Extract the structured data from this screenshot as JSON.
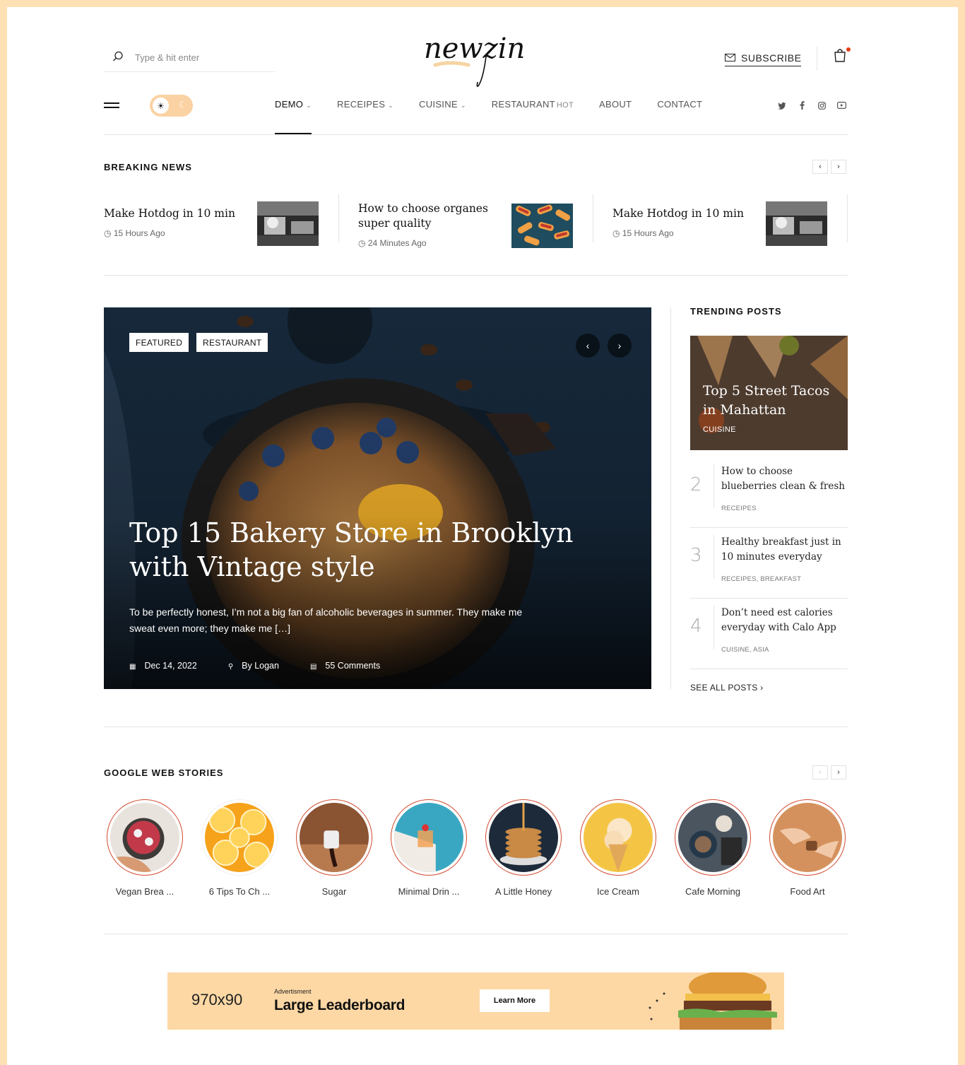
{
  "header": {
    "search_placeholder": "Type & hit enter",
    "logo_text": "newzin",
    "subscribe_label": "SUBSCRIBE"
  },
  "nav": {
    "items": [
      {
        "label": "DEMO",
        "caret": true,
        "active": true
      },
      {
        "label": "RECEIPES",
        "caret": true
      },
      {
        "label": "CUISINE",
        "caret": true
      },
      {
        "label": "RESTAURANT",
        "badge": "HOT"
      },
      {
        "label": "ABOUT"
      },
      {
        "label": "CONTACT"
      }
    ],
    "social_icons": [
      "twitter-icon",
      "facebook-icon",
      "instagram-icon",
      "youtube-icon"
    ]
  },
  "breaking": {
    "title": "BREAKING NEWS",
    "items": [
      {
        "title": "Make Hotdog in 10 min",
        "time": "15 Hours Ago"
      },
      {
        "title": "How to choose organes super quality",
        "time": "24 Minutes Ago"
      },
      {
        "title": "Make Hotdog in 10 min",
        "time": "15 Hours Ago"
      }
    ]
  },
  "hero": {
    "badges": [
      "FEATURED",
      "RESTAURANT"
    ],
    "title": "Top 15 Bakery Store in Brooklyn with Vintage style",
    "excerpt": "To be perfectly honest, I’m not a big fan of alcoholic beverages in summer. They make me sweat even more; they make me […]",
    "date": "Dec 14, 2022",
    "author": "By Logan",
    "comments": "55 Comments"
  },
  "trending": {
    "title": "TRENDING POSTS",
    "top": {
      "title": "Top 5 Street Tacos in Mahattan",
      "category": "CUISINE"
    },
    "items": [
      {
        "num": "2",
        "title": "How to choose blueberries clean & fresh",
        "category": "RECEIPES"
      },
      {
        "num": "3",
        "title": "Healthy breakfast just in 10 minutes everyday",
        "category": "RECEIPES, BREAKFAST"
      },
      {
        "num": "4",
        "title": "Don’t need est calories everyday with Calo App",
        "category": "CUISINE, ASIA"
      }
    ],
    "see_all": "SEE ALL POSTS"
  },
  "stories": {
    "title": "GOOGLE WEB STORIES",
    "items": [
      {
        "label": "Vegan Brea ..."
      },
      {
        "label": "6 Tips To Ch ..."
      },
      {
        "label": "Sugar"
      },
      {
        "label": "Minimal Drin ..."
      },
      {
        "label": "A Little Honey"
      },
      {
        "label": "Ice Cream"
      },
      {
        "label": "Cafe Morning"
      },
      {
        "label": "Food Art"
      }
    ]
  },
  "ad": {
    "size": "970x90",
    "small": "Advertisment",
    "big": "Large Leaderboard",
    "button": "Learn More"
  },
  "colors": {
    "accent_bg": "#fde0b3",
    "toggle": "#fbd2a3",
    "story_ring": "#d24a2f",
    "cart_dot": "#e23c16"
  }
}
